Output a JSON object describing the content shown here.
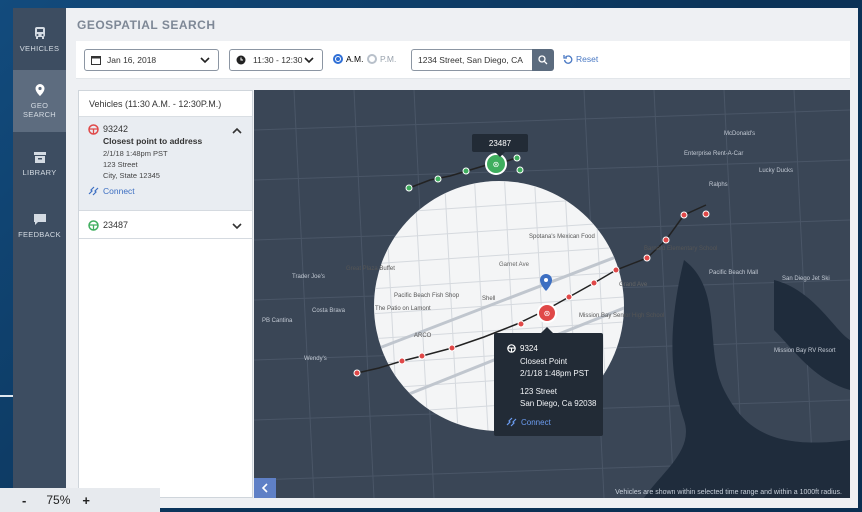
{
  "app": {
    "page_title": "GEOSPATIAL SEARCH"
  },
  "sidebar": {
    "items": [
      {
        "label": "VEHICLES",
        "icon": "bus-icon",
        "active": false
      },
      {
        "label": "GEO SEARCH",
        "icon": "map-pin-icon",
        "active": true
      },
      {
        "label": "LIBRARY",
        "icon": "archive-icon",
        "active": false
      },
      {
        "label": "FEEDBACK",
        "icon": "chat-icon",
        "active": false
      }
    ]
  },
  "toolbar": {
    "date_value": "Jan 16, 2018",
    "time_value": "11:30 - 12:30",
    "am_label": "A.M.",
    "pm_label": "P.M.",
    "am_selected": true,
    "address_value": "1234 Street, San Diego, CA",
    "reset_label": "Reset"
  },
  "panel": {
    "header": "Vehicles (11:30 A.M. - 12:30P.M.)",
    "vehicles": [
      {
        "id": "93242",
        "status_color": "#e04848",
        "expanded": true,
        "title": "Closest point to address",
        "time": "2/1/18 1:48pm PST",
        "street": "123 Street",
        "city": "City, State 12345",
        "connect_label": "Connect"
      },
      {
        "id": "23487",
        "status_color": "#3fae5e",
        "expanded": false
      }
    ]
  },
  "map": {
    "tooltip_label": "23487",
    "callout": {
      "id": "9324",
      "title": "Closest Point",
      "time": "2/1/18 1:48pm PST",
      "street": "123 Street",
      "city": "San Diego, Ca 92038",
      "connect_label": "Connect"
    },
    "labels": {
      "mexican_food": "Spotana's Mexican Food",
      "great_plaza": "Great Plaza Buffet",
      "fish_shop": "Pacific Beach Fish Shop",
      "lamont": "The Patio on Lamont",
      "shell": "Shell",
      "arco": "ARCO",
      "garnet_ave": "Garnet Ave",
      "grand_ave": "Grand Ave",
      "mission_bay": "Mission Bay Senior High School",
      "barnard": "Barnard Elementary School",
      "trader_joes": "Trader Joe's",
      "costa_brava": "Costa Brava",
      "wendys": "Wendy's",
      "pb_cantina": "PB Cantina",
      "ralphs": "Ralphs",
      "lucky_ducks": "Lucky Ducks",
      "mcdonalds": "McDonald's",
      "mission_bay_rv": "Mission Bay RV Resort",
      "pacific_beach_mall": "Pacific Beach Mall",
      "san_diego_jet": "San Diego Jet Ski",
      "enterprise": "Enterprise Rent-A-Car"
    },
    "footer_note": "Vehicles are shown within selected time range and within a 1000ft radius."
  },
  "zoom": {
    "level": "75%",
    "minus": "-",
    "plus": "+"
  },
  "colors": {
    "accent": "#2f6fd6",
    "red_route": "#e04848",
    "green_route": "#3fae5e",
    "map_dark": "#3a4656",
    "sidebar": "#3d4d61"
  }
}
